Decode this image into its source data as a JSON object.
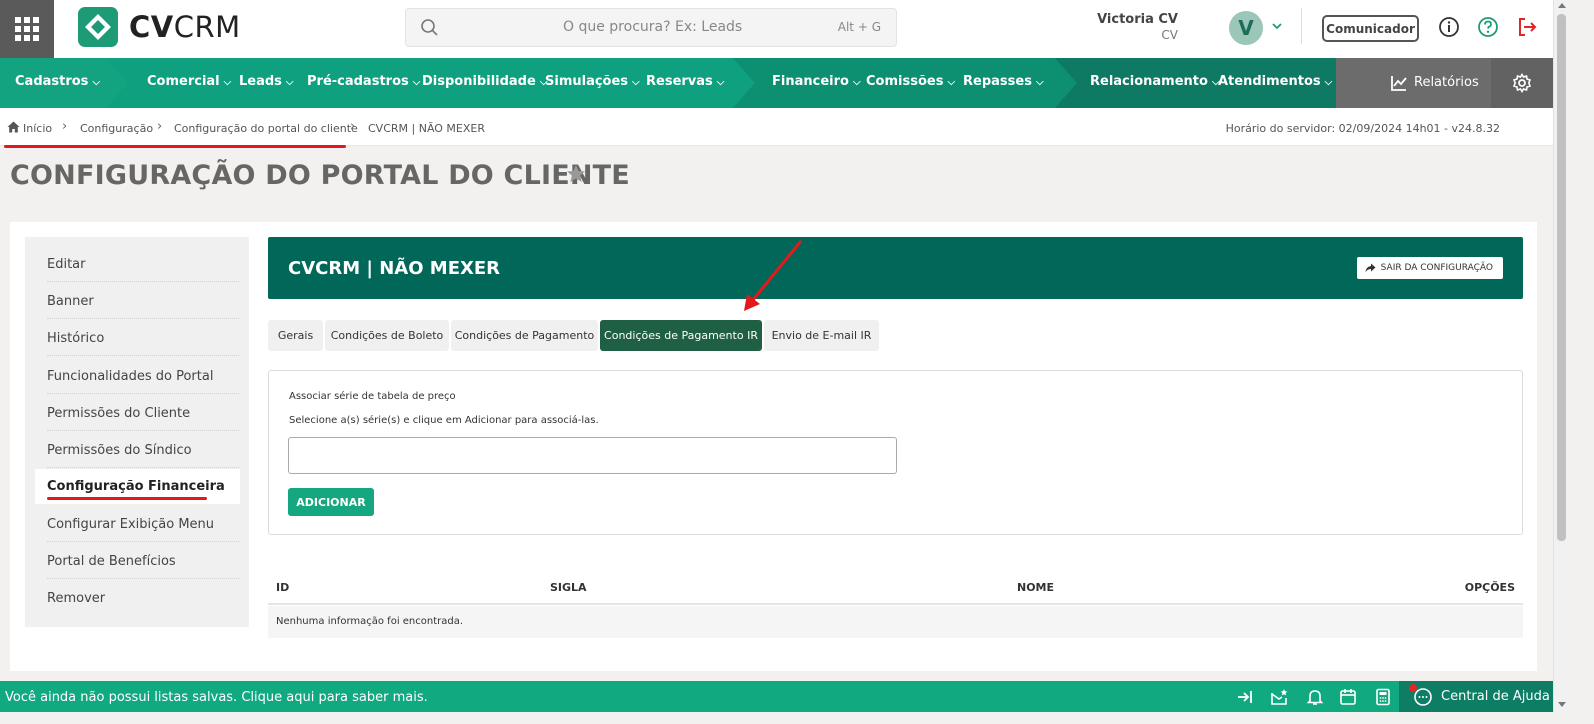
{
  "topbar": {
    "logo_bold": "CV",
    "logo_light": "CRM",
    "search_placeholder": "O que procura? Ex: Leads",
    "search_shortcut": "Alt + G",
    "user_name": "Victoria CV",
    "user_company": "CV",
    "avatar_initial": "V",
    "comunicador_label": "Comunicador",
    "icons": [
      "apps-grid-icon",
      "search-icon",
      "chevron-down-icon",
      "info-icon",
      "help-icon",
      "logout-icon"
    ],
    "accent_color": "#0f9a7b"
  },
  "nav": {
    "items": [
      {
        "label": "Cadastros"
      },
      {
        "label": "Comercial"
      },
      {
        "label": "Leads"
      },
      {
        "label": "Pré-cadastros"
      },
      {
        "label": "Disponibilidade"
      },
      {
        "label": "Simulações"
      },
      {
        "label": "Reservas"
      },
      {
        "label": "Financeiro"
      },
      {
        "label": "Comissões"
      },
      {
        "label": "Repasses"
      },
      {
        "label": "Relacionamento"
      },
      {
        "label": "Atendimentos"
      }
    ],
    "relatorios_label": "Relatórios"
  },
  "breadcrumb": {
    "items": [
      "Início",
      "Configuração",
      "Configuração do portal do cliente",
      "CVCRM | NÃO MEXER"
    ],
    "server_time": "Horário do servidor: 02/09/2024 14h01 - v24.8.32"
  },
  "page": {
    "title": "CONFIGURAÇÃO DO PORTAL DO CLIENTE"
  },
  "sidebar": {
    "items": [
      {
        "label": "Editar"
      },
      {
        "label": "Banner"
      },
      {
        "label": "Histórico"
      },
      {
        "label": "Funcionalidades do Portal"
      },
      {
        "label": "Permissões do Cliente"
      },
      {
        "label": "Permissões do Síndico"
      },
      {
        "label": "Configuração Financeira"
      },
      {
        "label": "Configurar Exibição Menu"
      },
      {
        "label": "Portal de Benefícios"
      },
      {
        "label": "Remover"
      }
    ],
    "active_index": 6
  },
  "content": {
    "header_title": "CVCRM | NÃO MEXER",
    "exit_label": "SAIR DA CONFIGURAÇÃO",
    "tabs": [
      {
        "label": "Gerais"
      },
      {
        "label": "Condições de Boleto"
      },
      {
        "label": "Condições de Pagamento"
      },
      {
        "label": "Condições de Pagamento IR"
      },
      {
        "label": "Envio de E-mail IR"
      }
    ],
    "active_tab": 3,
    "form": {
      "title": "Associar série de tabela de preço",
      "hint": "Selecione a(s) série(s) e clique em Adicionar para associá-las.",
      "input_value": "",
      "add_label": "ADICIONAR"
    },
    "table": {
      "columns": [
        "ID",
        "SIGLA",
        "NOME",
        "OPÇÕES"
      ],
      "empty_text": "Nenhuma informação foi encontrada."
    }
  },
  "bottombar": {
    "message": "Você ainda não possui listas salvas. Clique aqui para saber mais.",
    "help_label": "Central de Ajuda",
    "icons": [
      "collapse-right-icon",
      "mail-star-icon",
      "bell-icon",
      "calendar-icon",
      "calculator-icon",
      "chat-icon"
    ]
  }
}
